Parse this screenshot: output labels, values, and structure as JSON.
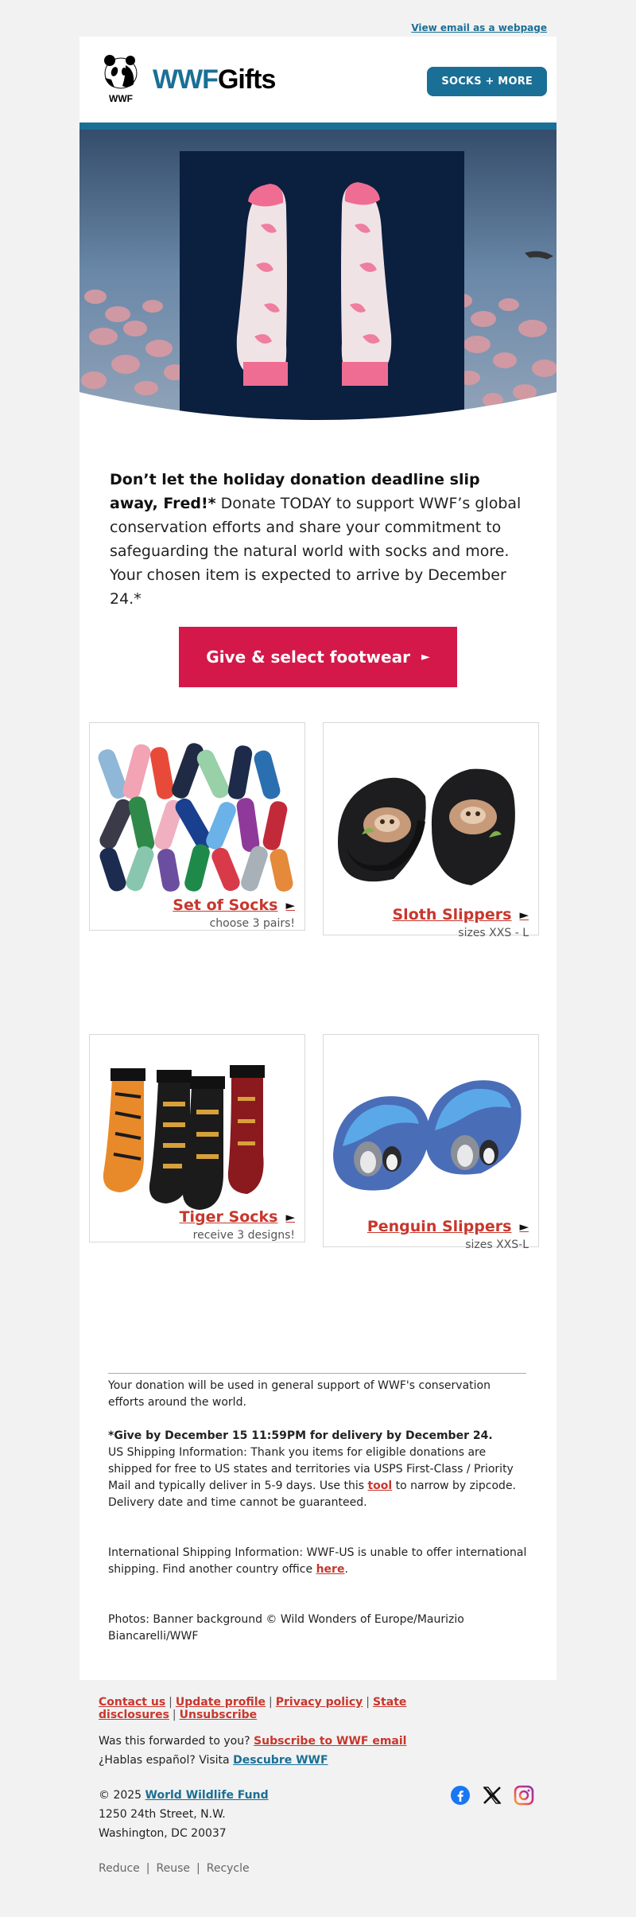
{
  "topbar": {
    "view_link": "View email as a webpage"
  },
  "header": {
    "logo_caption": "WWF",
    "brand_wwf": "WWF",
    "brand_gifts": "Gifts",
    "nav_button": "SOCKS + MORE"
  },
  "intro": {
    "headline": "Don’t let the holiday donation deadline slip away, Fred!*",
    "body": "Donate TODAY to support WWF’s global conservation efforts and share your commitment to safeguarding the natural world with socks and more. Your chosen item is expected to arrive by December 24.*"
  },
  "cta": {
    "label": "Give & select footwear",
    "arrow": "►"
  },
  "products": [
    {
      "name": "Set of Socks",
      "sub": "choose 3 pairs!",
      "arrow": "►"
    },
    {
      "name": "Sloth Slippers",
      "sub": "sizes XXS - L",
      "arrow": "►"
    },
    {
      "name": "Tiger Socks",
      "sub": "receive 3 designs!",
      "arrow": "►"
    },
    {
      "name": "Penguin Slippers",
      "sub": "sizes XXS-L",
      "arrow": "►"
    }
  ],
  "footnotes": {
    "general": "Your donation will be used in general support of WWF's conservation efforts around the world.",
    "deadline_bold": "*Give by December 15 11:59PM for delivery by December 24.",
    "us_shipping_a": "US Shipping Information: Thank you items for eligible donations are shipped for free to US states and territories via USPS First-Class / Priority Mail and typically deliver in 5-9 days. Use this ",
    "us_shipping_link": "tool",
    "us_shipping_b": " to narrow by zipcode. Delivery date and time cannot be guaranteed.",
    "intl_a": "International Shipping Information: WWF-US is unable to offer international shipping. Find another country office ",
    "intl_link": "here",
    "intl_b": ".",
    "photos": "Photos: Banner background © Wild Wonders of Europe/Maurizio Biancarelli/WWF"
  },
  "footer": {
    "links": [
      "Contact us",
      "Update profile",
      "Privacy policy",
      "State disclosures",
      "Unsubscribe"
    ],
    "separator": "|",
    "forwarded_text": "Was this forwarded to you? ",
    "forwarded_link": "Subscribe to WWF email",
    "spanish_text": "¿Hablas español? Visita ",
    "spanish_link": "Descubre WWF",
    "copyright_text": "© 2025 ",
    "copyright_link": "World Wildlife Fund",
    "address_line1": "1250 24th Street, N.W.",
    "address_line2": "Washington, DC 20037",
    "rrr": [
      "Reduce",
      "Reuse",
      "Recycle"
    ]
  },
  "social": [
    "facebook-icon",
    "x-icon",
    "instagram-icon"
  ],
  "colors": {
    "brand_blue": "#1a6f96",
    "cta_red": "#d4184a",
    "link_red": "#c8372d"
  }
}
